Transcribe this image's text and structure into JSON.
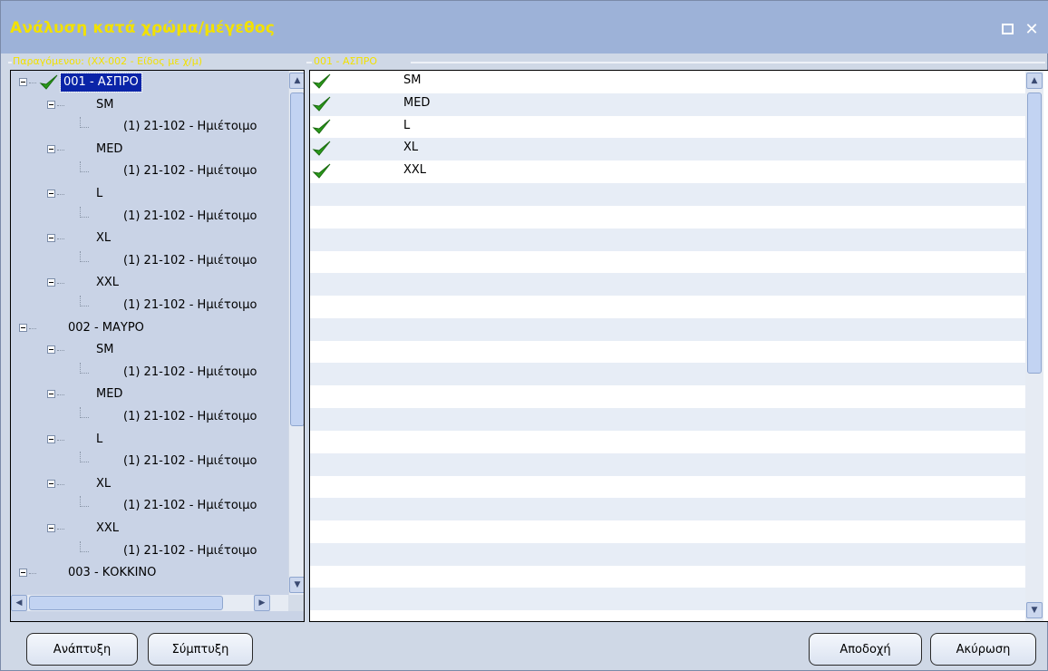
{
  "window": {
    "title": "Ανάλυση κατά χρώμα/μέγεθος",
    "maximize_icon": "maximize-icon",
    "close_icon": "close-icon",
    "close_glyph": "✕"
  },
  "left_group": {
    "legend": "Παραγόμενου: (XX-002 - Είδος με χ/μ)"
  },
  "right_group": {
    "legend": "001 - ΑΣΠΡΟ"
  },
  "tree": {
    "nodes": [
      {
        "level": 0,
        "label": "001 - ΑΣΠΡΟ",
        "selected": true,
        "checked": true
      },
      {
        "level": 1,
        "label": "SM"
      },
      {
        "level": 2,
        "label": "(1) 21-102 - Ημιέτοιμο"
      },
      {
        "level": 1,
        "label": "MED"
      },
      {
        "level": 2,
        "label": "(1) 21-102 - Ημιέτοιμο"
      },
      {
        "level": 1,
        "label": "L"
      },
      {
        "level": 2,
        "label": "(1) 21-102 - Ημιέτοιμο"
      },
      {
        "level": 1,
        "label": "XL"
      },
      {
        "level": 2,
        "label": "(1) 21-102 - Ημιέτοιμο"
      },
      {
        "level": 1,
        "label": "XXL"
      },
      {
        "level": 2,
        "label": "(1) 21-102 - Ημιέτοιμο"
      },
      {
        "level": 0,
        "label": "002 - ΜΑΥΡΟ"
      },
      {
        "level": 1,
        "label": "SM"
      },
      {
        "level": 2,
        "label": "(1) 21-102 - Ημιέτοιμο"
      },
      {
        "level": 1,
        "label": "MED"
      },
      {
        "level": 2,
        "label": "(1) 21-102 - Ημιέτοιμο"
      },
      {
        "level": 1,
        "label": "L"
      },
      {
        "level": 2,
        "label": "(1) 21-102 - Ημιέτοιμο"
      },
      {
        "level": 1,
        "label": "XL"
      },
      {
        "level": 2,
        "label": "(1) 21-102 - Ημιέτοιμο"
      },
      {
        "level": 1,
        "label": "XXL"
      },
      {
        "level": 2,
        "label": "(1) 21-102 - Ημιέτοιμο"
      },
      {
        "level": 0,
        "label": "003 - ΚΟΚΚΙΝΟ"
      }
    ]
  },
  "list": {
    "rows": [
      {
        "checked": true,
        "label": "SM"
      },
      {
        "checked": true,
        "label": "MED"
      },
      {
        "checked": true,
        "label": "L"
      },
      {
        "checked": true,
        "label": "XL"
      },
      {
        "checked": true,
        "label": "XXL"
      }
    ],
    "check_color": "#2a9a1a"
  },
  "buttons": {
    "expand": "Ανάπτυξη",
    "collapse": "Σύμπτυξη",
    "accept": "Αποδοχή",
    "cancel": "Ακύρωση"
  },
  "colors": {
    "title_bar": "#9db2d8",
    "title_text": "#f2e100",
    "selection": "#0a24a8"
  }
}
